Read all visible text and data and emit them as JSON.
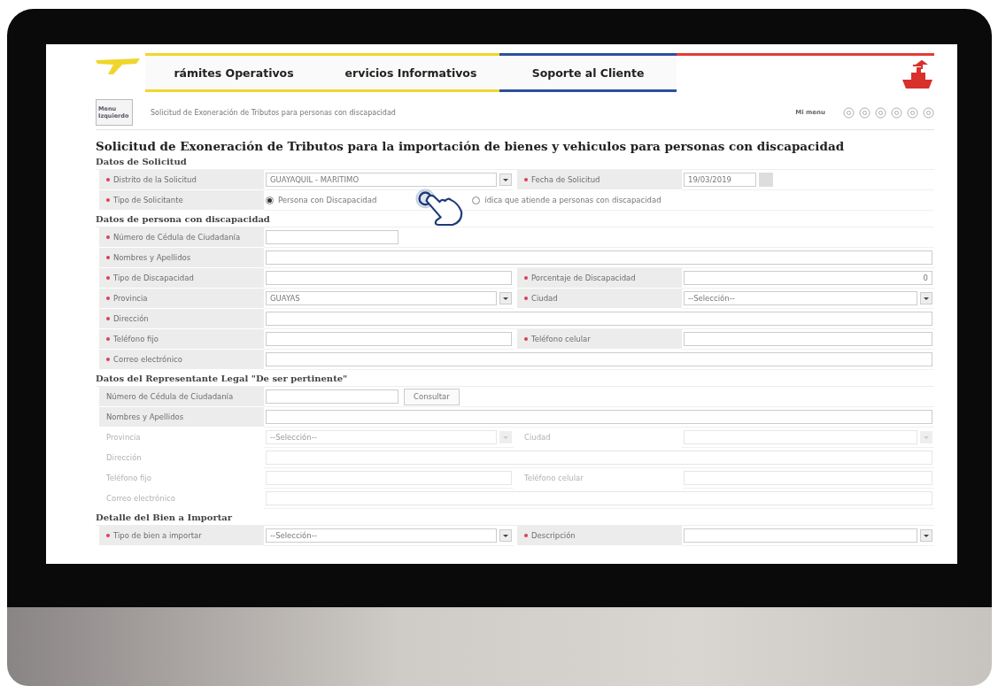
{
  "header": {
    "tabs": [
      {
        "label": "rámites Operativos",
        "color": "#f0d62c"
      },
      {
        "label": "ervicios Informativos",
        "color": "#f0d62c"
      },
      {
        "label": "Soporte al Cliente",
        "color": "#2c4f9e"
      }
    ]
  },
  "toolbar": {
    "menu_button": "Menu Izquierdo",
    "breadcrumb": "Solicitud de Exoneración de Tributos para personas con discapacidad",
    "my_menu_label": "Mi menu"
  },
  "page_title": "Solicitud de Exoneración de Tributos para la importación de bienes y vehiculos para personas con discapacidad",
  "sections": [
    {
      "title": "Datos de Solicitud",
      "rows": [
        [
          {
            "label": "Distrito de la Solicitud",
            "required": true,
            "disabled": false,
            "control": {
              "kind": "select",
              "value": "GUAYAQUIL - MARITIMO"
            }
          },
          {
            "label": "Fecha de Solicitud",
            "required": true,
            "disabled": false,
            "control": {
              "kind": "date",
              "value": "19/03/2019"
            }
          }
        ],
        [
          {
            "label": "Tipo de Solicitante",
            "required": true,
            "disabled": false,
            "control": {
              "kind": "radio",
              "options": [
                {
                  "label": "Persona con Discapacidad",
                  "selected": true
                },
                {
                  "label": "ídica que atiende a personas con discapacidad",
                  "selected": false
                }
              ]
            }
          }
        ]
      ]
    },
    {
      "title": "Datos de persona con discapacidad",
      "rows": [
        [
          {
            "label": "Número de Cédula de Ciudadanía",
            "required": true,
            "disabled": false,
            "control": {
              "kind": "lookup"
            }
          }
        ],
        [
          {
            "label": "Nombres y Apellidos",
            "required": true,
            "disabled": false,
            "control": {
              "kind": "text"
            }
          }
        ],
        [
          {
            "label": "Tipo de Discapacidad",
            "required": true,
            "disabled": false,
            "control": {
              "kind": "text"
            }
          },
          {
            "label": "Porcentaje de Discapacidad",
            "required": true,
            "disabled": false,
            "control": {
              "kind": "number",
              "value": "0"
            }
          }
        ],
        [
          {
            "label": "Provincia",
            "required": true,
            "disabled": false,
            "control": {
              "kind": "select",
              "value": "GUAYAS"
            }
          },
          {
            "label": "Ciudad",
            "required": true,
            "disabled": false,
            "control": {
              "kind": "select",
              "value": "--Selección--"
            }
          }
        ],
        [
          {
            "label": "Dirección",
            "required": true,
            "disabled": false,
            "control": {
              "kind": "text"
            }
          }
        ],
        [
          {
            "label": "Teléfono fijo",
            "required": true,
            "disabled": false,
            "control": {
              "kind": "text"
            }
          },
          {
            "label": "Teléfono celular",
            "required": true,
            "disabled": false,
            "control": {
              "kind": "text"
            }
          }
        ],
        [
          {
            "label": "Correo electrónico",
            "required": true,
            "disabled": false,
            "control": {
              "kind": "text"
            }
          }
        ]
      ]
    },
    {
      "title": "Datos del Representante Legal \"De ser pertinente\"",
      "rows": [
        [
          {
            "label": "Número de Cédula de Ciudadanía",
            "required": false,
            "disabled": false,
            "control": {
              "kind": "lookup",
              "button": "Consultar"
            }
          }
        ],
        [
          {
            "label": "Nombres y Apellidos",
            "required": false,
            "disabled": false,
            "control": {
              "kind": "text"
            }
          }
        ],
        [
          {
            "label": "Provincia",
            "required": false,
            "disabled": true,
            "control": {
              "kind": "select",
              "value": "--Selección--"
            }
          },
          {
            "label": "Ciudad",
            "required": false,
            "disabled": true,
            "control": {
              "kind": "select"
            }
          }
        ],
        [
          {
            "label": "Dirección",
            "required": false,
            "disabled": true,
            "control": {
              "kind": "text"
            }
          }
        ],
        [
          {
            "label": "Teléfono fijo",
            "required": false,
            "disabled": true,
            "control": {
              "kind": "text"
            }
          },
          {
            "label": "Teléfono celular",
            "required": false,
            "disabled": true,
            "control": {
              "kind": "text"
            }
          }
        ],
        [
          {
            "label": "Correo electrónico",
            "required": false,
            "disabled": true,
            "control": {
              "kind": "text"
            }
          }
        ]
      ]
    },
    {
      "title": "Detalle del Bien a Importar",
      "rows": [
        [
          {
            "label": "Tipo de bien a importar",
            "required": true,
            "disabled": false,
            "control": {
              "kind": "select",
              "value": "--Selección--"
            }
          },
          {
            "label": "Descripción",
            "required": true,
            "disabled": false,
            "control": {
              "kind": "select"
            }
          }
        ]
      ]
    }
  ]
}
